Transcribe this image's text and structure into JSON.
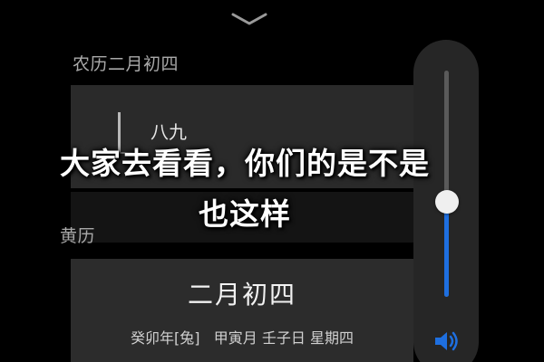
{
  "header": {
    "collapse_icon": "chevron-down-icon"
  },
  "lunar_section": {
    "label": "农历二月初四",
    "picker_partial_text": "八九"
  },
  "gregorian_section": {
    "label": "黄历"
  },
  "date_card": {
    "title": "二月初四",
    "subtitle": "癸卯年[兔]   甲寅月 壬子日 星期四"
  },
  "volume": {
    "level_fraction": 0.42,
    "accent_color": "#1e6fe0",
    "icon": "speaker-icon"
  },
  "caption": {
    "line1": "大家去看看，你们的是不是",
    "line2": "也这样"
  }
}
